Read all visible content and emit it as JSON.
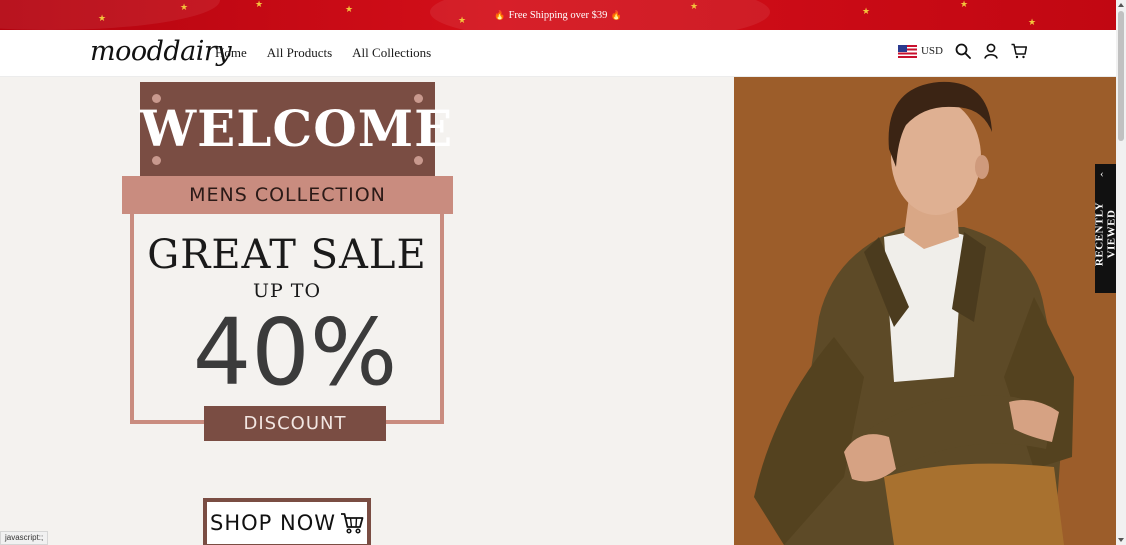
{
  "announcement": {
    "text": "Free Shipping over $39",
    "icon": "fire-icon"
  },
  "header": {
    "logo": "mooddairy",
    "nav": [
      {
        "label": "Home"
      },
      {
        "label": "All Products"
      },
      {
        "label": "All Collections"
      }
    ],
    "currency": "USD",
    "icons": [
      "us-flag-icon",
      "search-icon",
      "account-icon",
      "cart-icon"
    ]
  },
  "hero": {
    "welcome": "WELCOME",
    "collection": "MENS COLLECTION",
    "headline": "GREAT SALE",
    "up_to": "UP TO",
    "percent": "40%",
    "discount": "DISCOUNT",
    "cta": "SHOP NOW"
  },
  "recently_viewed": {
    "label": "RECENTLY VIEWED"
  },
  "status_bar": {
    "text": "javascript:;"
  },
  "colors": {
    "announcement_bg": "#c40a14",
    "welcome_bg": "#7a4d43",
    "accent_pink": "#c98c7f",
    "photo_bg": "#9c5d2a",
    "hero_bg": "#f4f2ef"
  }
}
